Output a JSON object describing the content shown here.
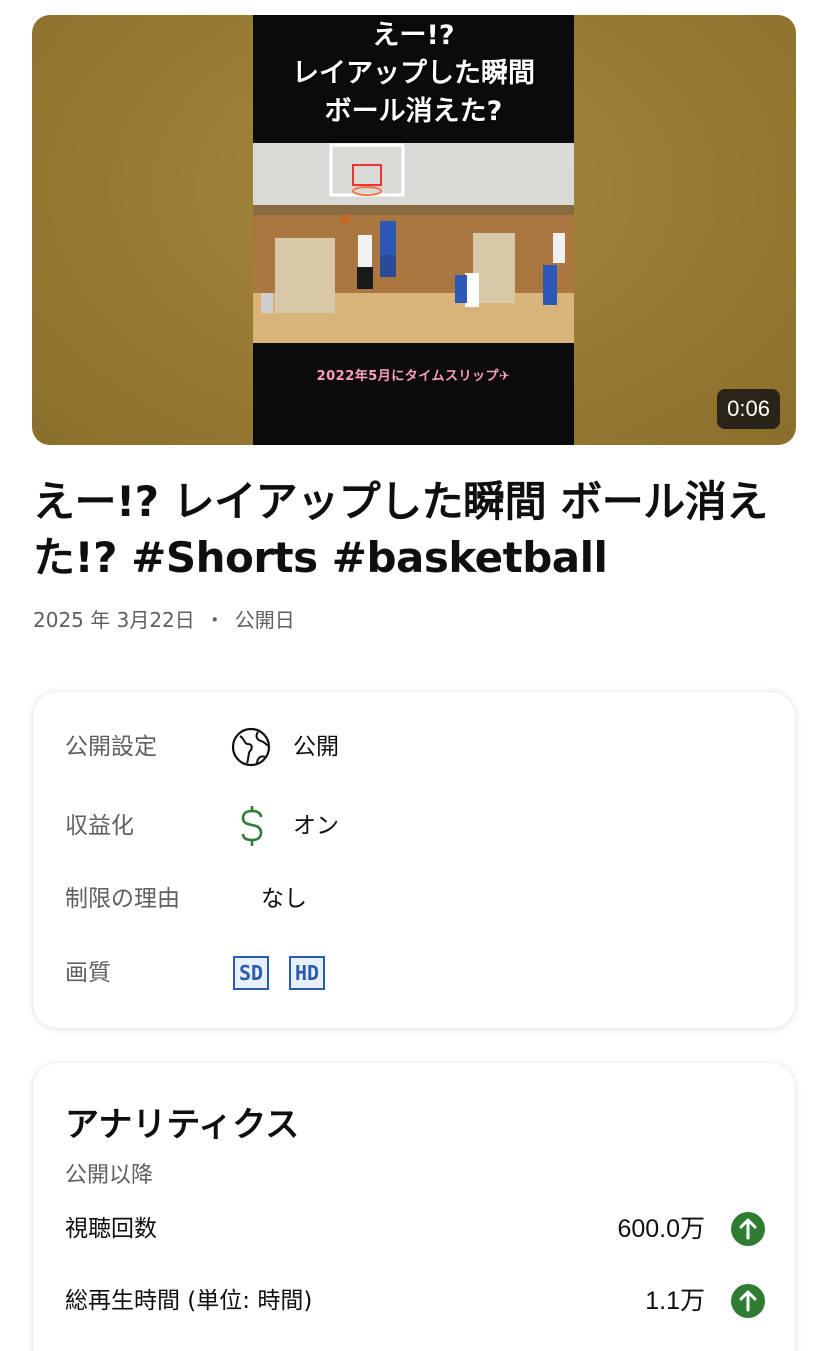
{
  "video": {
    "overlay_line1": "えー!?",
    "overlay_line2": "レイアップした瞬間",
    "overlay_line3": "ボール消えた?",
    "caption": "2022年5月にタイムスリップ✈",
    "duration": "0:06",
    "title": "えー!? レイアップした瞬間 ボール消えた!? #Shorts #basketball",
    "date": "2025 年 3月22日",
    "date_label": "公開日"
  },
  "details": {
    "visibility_label": "公開設定",
    "visibility_value": "公開",
    "visibility_icon": "globe-icon",
    "monetization_label": "収益化",
    "monetization_value": "オン",
    "monetization_icon": "dollar-icon",
    "restriction_label": "制限の理由",
    "restriction_value": "なし",
    "quality_label": "画質",
    "quality_badges": [
      "SD",
      "HD"
    ]
  },
  "analytics": {
    "title": "アナリティクス",
    "subtitle": "公開以降",
    "rows": [
      {
        "label": "視聴回数",
        "value": "600.0万",
        "icon": "arrow-up-icon"
      },
      {
        "label": "総再生時間 (単位: 時間)",
        "value": "1.1万",
        "icon": "arrow-up-icon"
      }
    ]
  },
  "colors": {
    "accent_green": "#2e7d32",
    "badge_blue": "#2a5db0",
    "secondary_text": "#606060"
  }
}
